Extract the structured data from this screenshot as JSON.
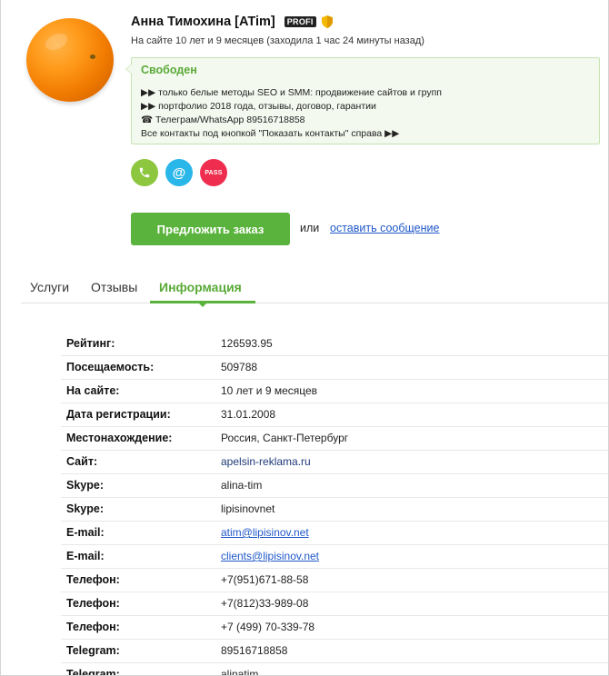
{
  "profile": {
    "name": "Анна Тимохина [ATim]",
    "badge": "PROFI",
    "online": "На сайте 10 лет и 9 месяцев (заходила 1 час 24 минуты назад)"
  },
  "status": {
    "title": "Свободен",
    "lines": [
      "▶▶ только белые методы SEO и SMM: продвижение сайтов и групп",
      "▶▶ портфолио 2018 года, отзывы, договор, гарантии",
      "☎ Телеграм/WhatsApp 89516718858",
      "Все контакты под кнопкой \"Показать контакты\" справа ▶▶"
    ]
  },
  "contact_buttons": {
    "phone": "✆",
    "mail": "@",
    "pass": "PASS"
  },
  "actions": {
    "order_label": "Предложить заказ",
    "or_text": "или",
    "message_link": "оставить сообщение"
  },
  "tabs": [
    {
      "label": "Услуги"
    },
    {
      "label": "Отзывы"
    },
    {
      "label": "Информация"
    }
  ],
  "info": [
    {
      "label": "Рейтинг:",
      "value": "126593.95"
    },
    {
      "label": "Посещаемость:",
      "value": "509788"
    },
    {
      "label": "На сайте:",
      "value": "10 лет и 9 месяцев"
    },
    {
      "label": "Дата регистрации:",
      "value": "31.01.2008"
    },
    {
      "label": "Местонахождение:",
      "value": "Россия, Санкт-Петербург"
    },
    {
      "label": "Сайт:",
      "value": "apelsin-reklama.ru"
    },
    {
      "label": "Skype:",
      "value": "alina-tim"
    },
    {
      "label": "Skype:",
      "value": "lipisinovnet"
    },
    {
      "label": "E-mail:",
      "value": "atim@lipisinov.net"
    },
    {
      "label": "E-mail:",
      "value": "clients@lipisinov.net"
    },
    {
      "label": "Телефон:",
      "value": "+7(951)671-88-58"
    },
    {
      "label": "Телефон:",
      "value": "+7(812)33-989-08"
    },
    {
      "label": "Телефон:",
      "value": "+7 (499) 70-339-78"
    },
    {
      "label": "Telegram:",
      "value": "89516718858"
    },
    {
      "label": "Telegram:",
      "value": "alinatim"
    }
  ],
  "colors": {
    "accent_green": "#5ab33c",
    "status_title": "#5aaa38",
    "link_blue": "#2058c8",
    "phone_circle": "#8dc63f",
    "mail_circle": "#29b6e8",
    "pass_circle": "#ef2d4f"
  }
}
